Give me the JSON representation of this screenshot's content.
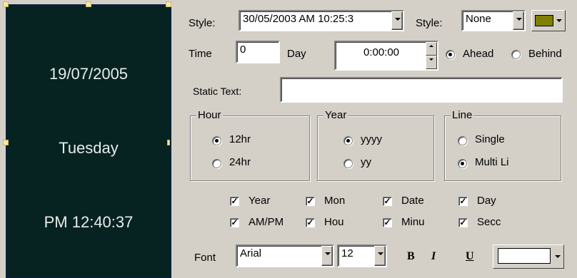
{
  "preview": {
    "date": "19/07/2005",
    "day": "Tuesday",
    "time": "PM 12:40:37",
    "background_color": "#062322",
    "text_color": "#e8ecea"
  },
  "row1": {
    "style_label": "Style:",
    "style_value": "30/05/2003 AM 10:25:3",
    "style2_label": "Style:",
    "style2_value": "None",
    "color_value": "#808000"
  },
  "row2": {
    "time_label": "Time",
    "time_value": "0",
    "day_label": "Day",
    "day_value": "0:00:00",
    "ahead_label": "Ahead",
    "behind_label": "Behind",
    "ahead_selected": true
  },
  "static_text": {
    "label": "Static Text:",
    "value": ""
  },
  "hour_group": {
    "title": "Hour",
    "options": [
      "12hr",
      "24hr"
    ],
    "selected": "12hr"
  },
  "year_group": {
    "title": "Year",
    "options": [
      "yyyy",
      "yy"
    ],
    "selected": "yyyy"
  },
  "line_group": {
    "title": "Line",
    "options": [
      "Single",
      "Multi Li"
    ],
    "selected": "Multi Li"
  },
  "checkboxes": {
    "year": "Year",
    "month": "Mon",
    "date": "Date",
    "day": "Day",
    "ampm": "AM/PM",
    "hour": "Hou",
    "minute": "Minu",
    "second": "Secc"
  },
  "font_row": {
    "label": "Font",
    "font_value": "Arial",
    "size_value": "12",
    "bold": "B",
    "italic": "I",
    "underline": "U",
    "font_color": "#ffffff"
  }
}
